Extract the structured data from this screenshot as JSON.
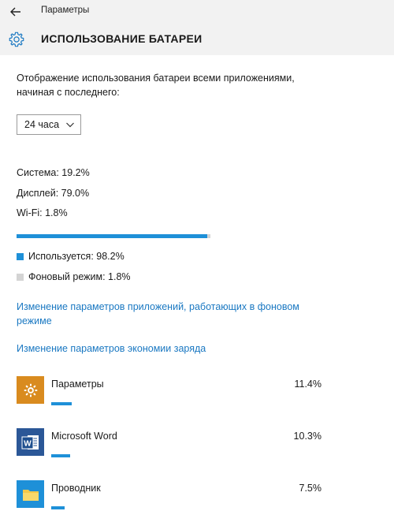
{
  "window": {
    "title": "Параметры"
  },
  "header": {
    "title": "ИСПОЛЬЗОВАНИЕ БАТАРЕИ"
  },
  "description": "Отображение использования батареи всеми приложениями, начиная с последнего:",
  "period": {
    "selected": "24 часа"
  },
  "stats": {
    "system": "Система: 19.2%",
    "display": "Дисплей: 79.0%",
    "wifi": "Wi-Fi: 1.8%"
  },
  "usage_bar": {
    "used_fraction": 0.982,
    "used_color": "#1e90d8",
    "track_color": "#d4d4d4"
  },
  "legend": {
    "used": {
      "label": "Используется: 98.2%",
      "color": "#1e90d8"
    },
    "background": {
      "label": "Фоновый режим: 1.8%",
      "color": "#d4d4d4"
    }
  },
  "links": {
    "background_apps": "Изменение параметров приложений, работающих в фоновом режиме",
    "battery_saver": "Изменение параметров экономии заряда"
  },
  "apps": [
    {
      "name": "Параметры",
      "percent": "11.4%",
      "icon": "gear-icon",
      "icon_bg": "#d98b1f",
      "bar_fraction": 0.114
    },
    {
      "name": "Microsoft Word",
      "percent": "10.3%",
      "icon": "word-icon",
      "icon_bg": "#2b5797",
      "bar_fraction": 0.103
    },
    {
      "name": "Проводник",
      "percent": "7.5%",
      "icon": "folder-icon",
      "icon_bg": "#1e90d8",
      "bar_fraction": 0.075
    }
  ]
}
